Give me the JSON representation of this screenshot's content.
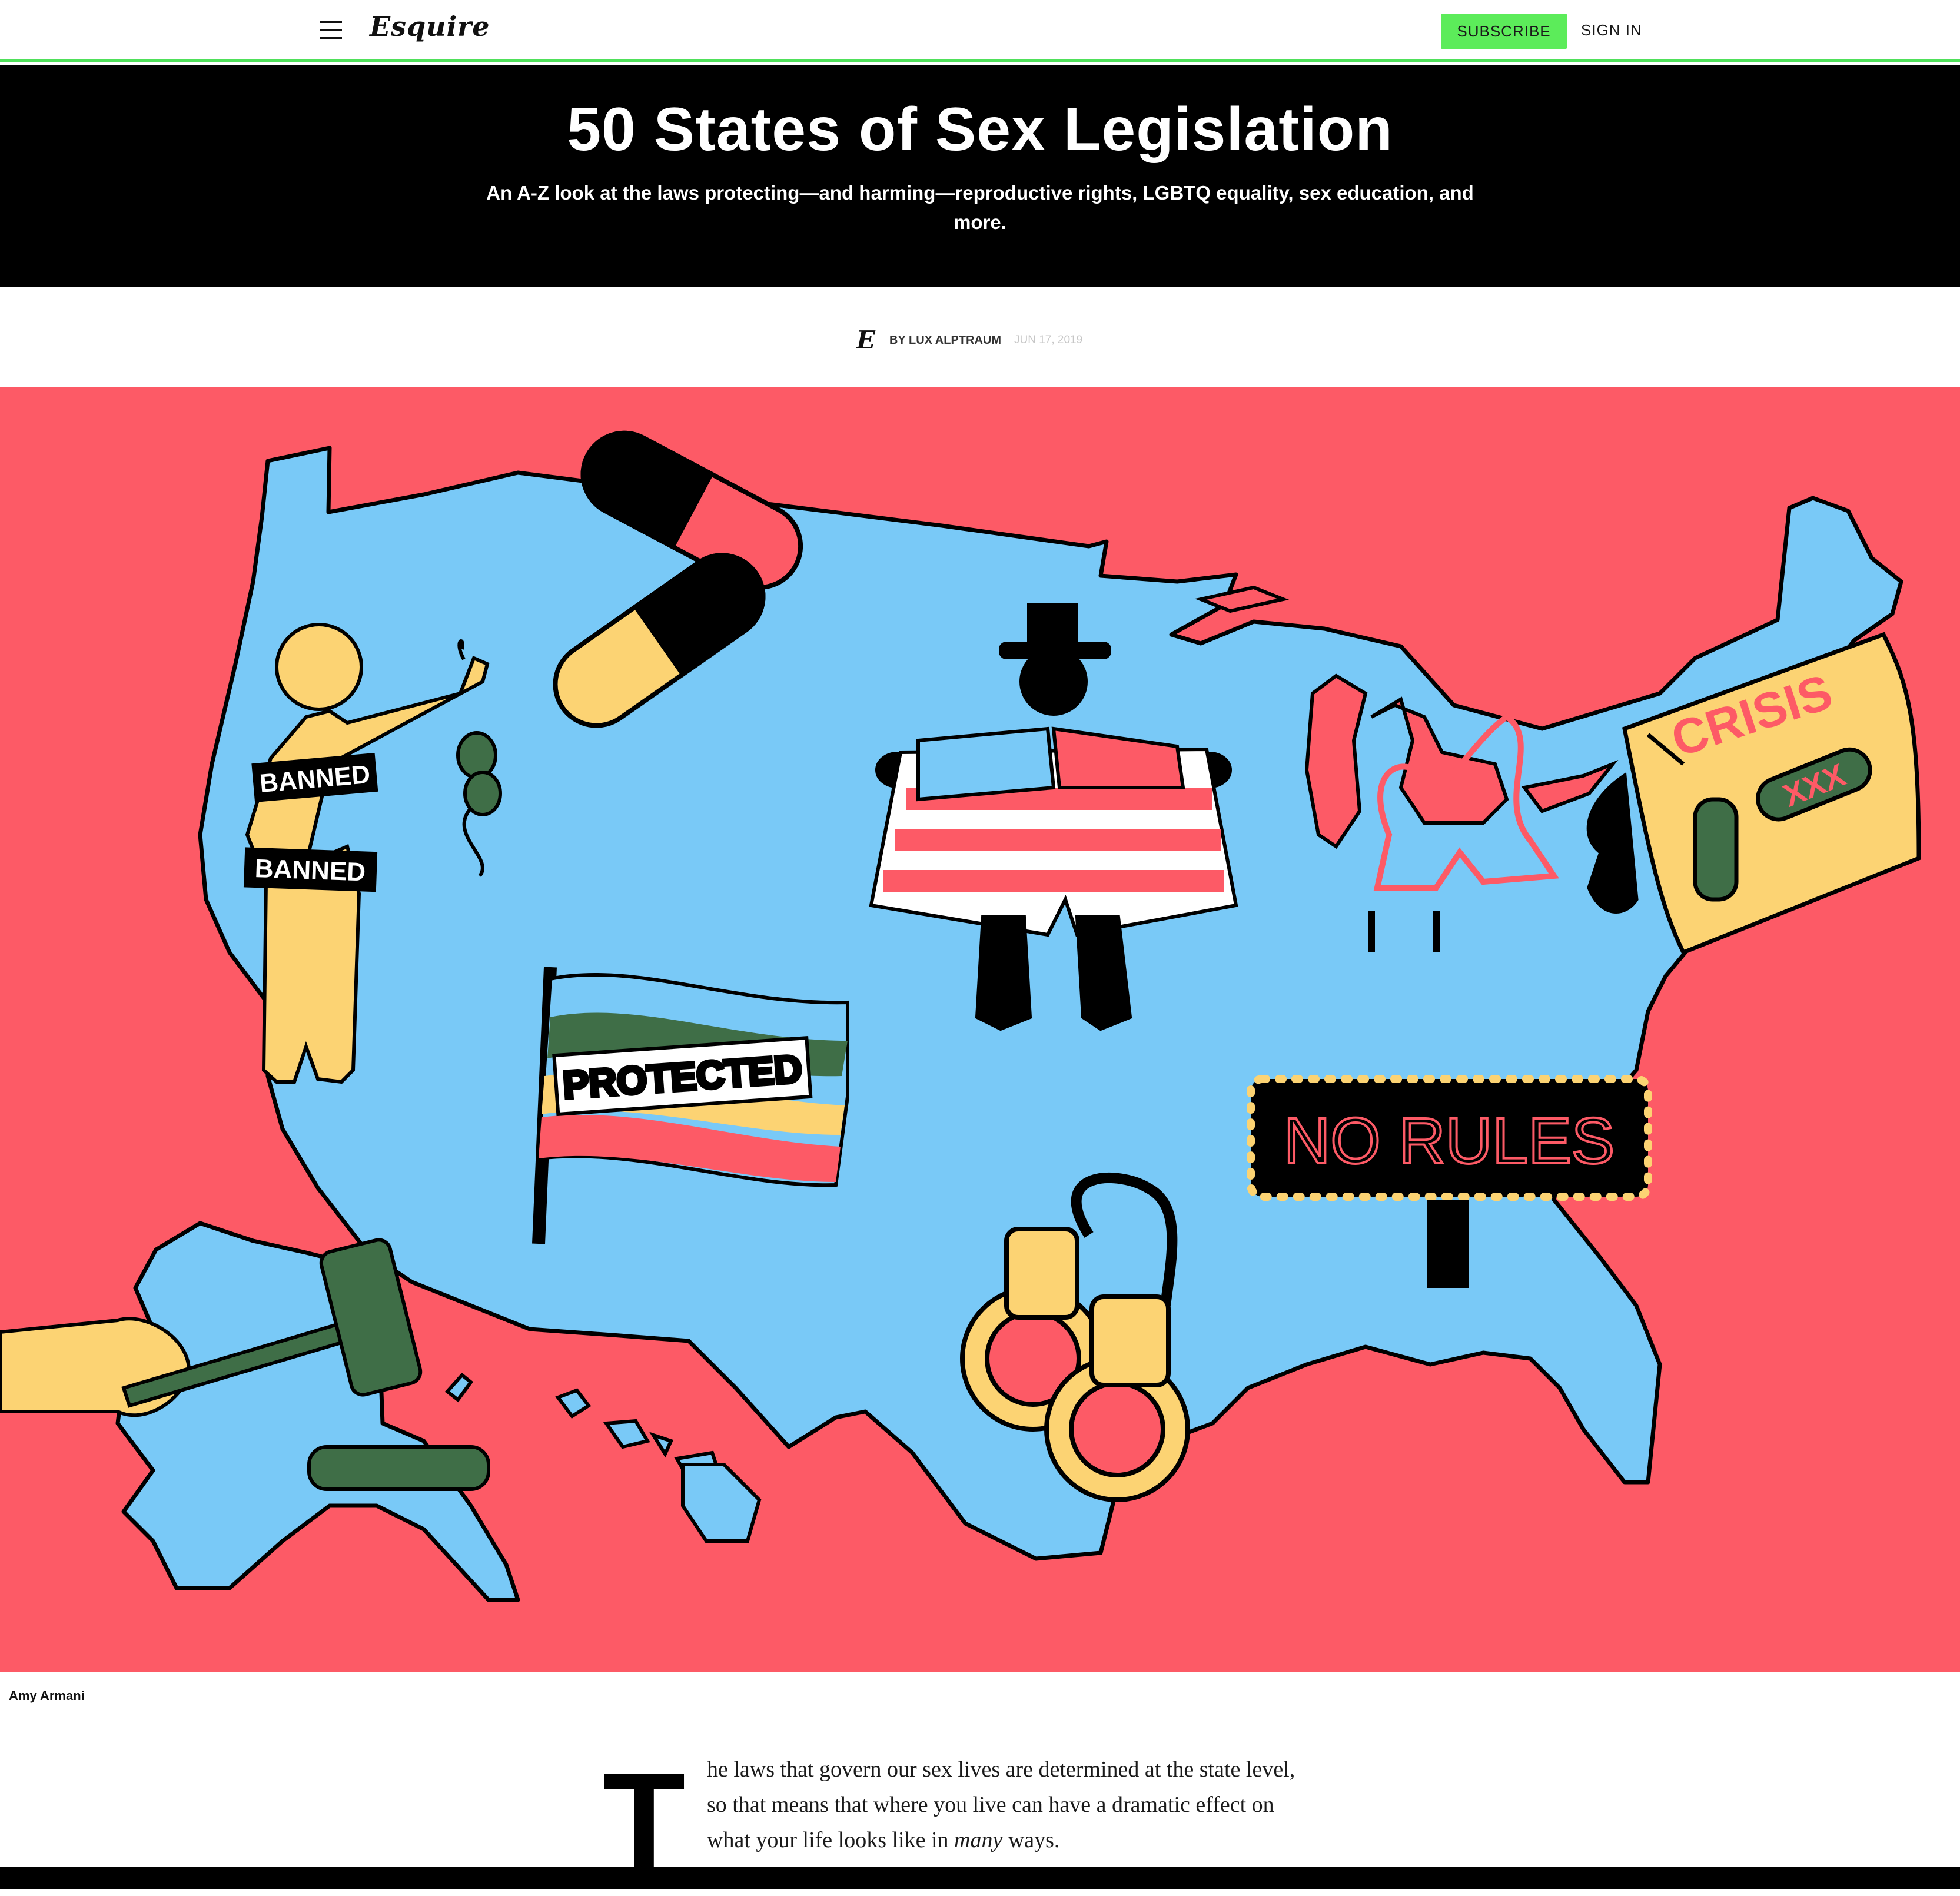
{
  "nav": {
    "logo": "Esquire",
    "subscribe_label": "SUBSCRIBE",
    "signin_label": "SIGN IN",
    "accent_color": "#5cec5a"
  },
  "hero": {
    "title": "50 States of Sex Legislation",
    "dek": "An A-Z look at the laws protecting—and harming—reproductive rights, LGBTQ equality, sex education, and more."
  },
  "byline": {
    "icon": "E",
    "author": "BY LUX ALPTRAUM",
    "date": "JUN 17, 2019"
  },
  "illustration": {
    "background_color": "#fd5a66",
    "map_color": "#79c9f7",
    "labels": {
      "banned_top": "BANNED",
      "banned_bottom": "BANNED",
      "protected": "PROTECTED",
      "crisis": "CRISIS",
      "xxx": "XXX",
      "no_rules": "NO RULES"
    },
    "credit": "Amy Armani"
  },
  "article": {
    "drop_cap": "T",
    "line1": "he laws that govern our sex lives are determined at the state level,",
    "line2": "so that means that where you live can have a dramatic effect on",
    "line3_pre": "what your life looks like in ",
    "line3_em": "many",
    "line3_post": " ways."
  }
}
